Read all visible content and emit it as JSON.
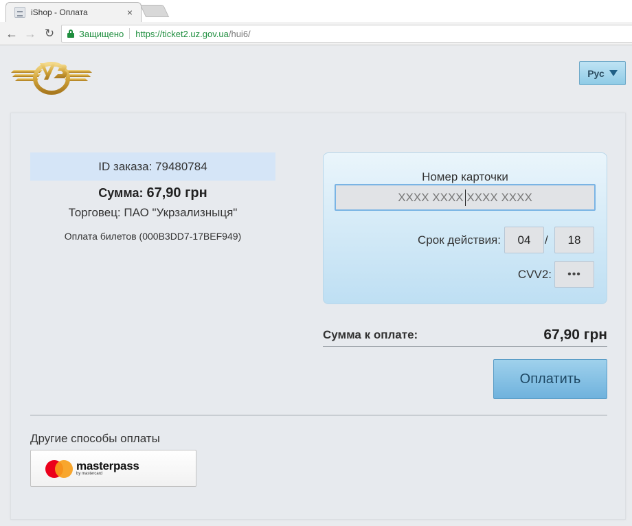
{
  "browser": {
    "tab_title": "iShop - Оплата",
    "tab_close": "×",
    "secure_label": "Защищено",
    "url_main": "https://ticket2.uz.gov.ua",
    "url_path": "/hui6/"
  },
  "header": {
    "logo_icon": "uz-railway-logo",
    "lang_label": "Рус"
  },
  "order": {
    "id_text": "ID заказа: 79480784",
    "sum_label": "Сумма:",
    "sum_value": "67,90 грн",
    "merchant": "Торговец: ПАО \"Укрзализныця\"",
    "description": "Оплата билетов (000B3DD7-17BEF949)"
  },
  "card": {
    "number_label": "Номер карточки",
    "number_placeholder": "XXXX XXXX XXXX XXXX",
    "expiry_label": "Срок действия:",
    "expiry_month": "04",
    "expiry_slash": "/",
    "expiry_year": "18",
    "cvv_label": "CVV2:",
    "cvv_value": "•••"
  },
  "total": {
    "label": "Сумма к оплате:",
    "value": "67,90 грн"
  },
  "pay_button": "Оплатить",
  "other": {
    "label": "Другие способы оплаты",
    "masterpass_word": "masterpass",
    "masterpass_sub": "by mastercard"
  },
  "colors": {
    "accent": "#8fcbe6",
    "secure_green": "#1e8e3e",
    "order_id_bg": "#d5e5f7",
    "mastercard_red": "#eb001b",
    "mastercard_orange": "#f79e1b"
  }
}
